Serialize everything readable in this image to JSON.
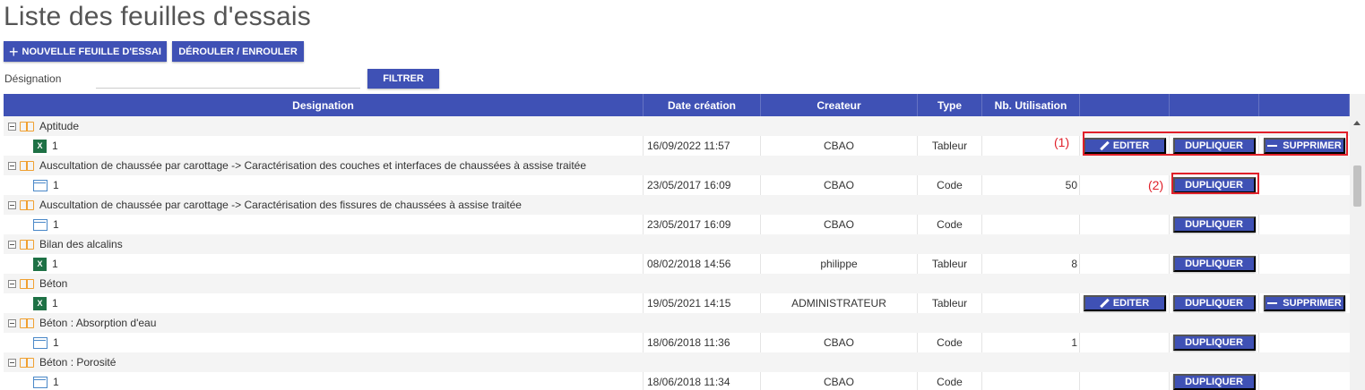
{
  "page": {
    "title": "Liste des feuilles d'essais"
  },
  "toolbar": {
    "new_sheet_label": "NOUVELLE FEUILLE D'ESSAI",
    "toggle_label": "DÉROULER / ENROULER"
  },
  "filter": {
    "label": "Désignation",
    "value": "",
    "button_label": "FILTRER"
  },
  "table": {
    "columns": [
      "Designation",
      "Date création",
      "Createur",
      "Type",
      "Nb. Utilisation",
      "",
      "",
      ""
    ],
    "groups": [
      {
        "name": "Aptitude",
        "item": {
          "version": "1",
          "icon": "excel-icon",
          "date": "16/09/2022 11:57",
          "creator": "CBAO",
          "type": "Tableur",
          "usage": "",
          "actions": [
            "edit",
            "duplicate",
            "delete"
          ]
        }
      },
      {
        "name": "Auscultation de chaussée par carottage -> Caractérisation des couches et interfaces de chaussées à assise traitée",
        "item": {
          "version": "1",
          "icon": "window-icon",
          "date": "23/05/2017 16:09",
          "creator": "CBAO",
          "type": "Code",
          "usage": "50",
          "actions": [
            "duplicate"
          ]
        }
      },
      {
        "name": "Auscultation de chaussée par carottage -> Caractérisation des fissures de chaussées à assise traitée",
        "item": {
          "version": "1",
          "icon": "window-icon",
          "date": "23/05/2017 16:09",
          "creator": "CBAO",
          "type": "Code",
          "usage": "",
          "actions": [
            "duplicate"
          ]
        }
      },
      {
        "name": "Bilan des alcalins",
        "item": {
          "version": "1",
          "icon": "excel-icon",
          "date": "08/02/2018 14:56",
          "creator": "philippe",
          "type": "Tableur",
          "usage": "8",
          "actions": [
            "duplicate"
          ]
        }
      },
      {
        "name": "Béton",
        "item": {
          "version": "1",
          "icon": "excel-icon",
          "date": "19/05/2021 14:15",
          "creator": "ADMINISTRATEUR",
          "type": "Tableur",
          "usage": "",
          "actions": [
            "edit",
            "duplicate",
            "delete"
          ]
        }
      },
      {
        "name": "Béton : Absorption d'eau",
        "item": {
          "version": "1",
          "icon": "window-icon",
          "date": "18/06/2018 11:36",
          "creator": "CBAO",
          "type": "Code",
          "usage": "1",
          "actions": [
            "duplicate"
          ]
        }
      },
      {
        "name": "Béton : Porosité",
        "item": {
          "version": "1",
          "icon": "window-icon",
          "date": "18/06/2018 11:34",
          "creator": "CBAO",
          "type": "Code",
          "usage": "",
          "actions": [
            "duplicate"
          ]
        }
      }
    ],
    "action_labels": {
      "edit": "EDITER",
      "duplicate": "DUPLIQUER",
      "delete": "SUPPRIMER"
    }
  },
  "annotations": [
    "(1)",
    "(2)"
  ],
  "colors": {
    "primary": "#3f51b5",
    "highlight": "#e0202a",
    "folder": "#f0a030",
    "excel": "#1e7145"
  }
}
